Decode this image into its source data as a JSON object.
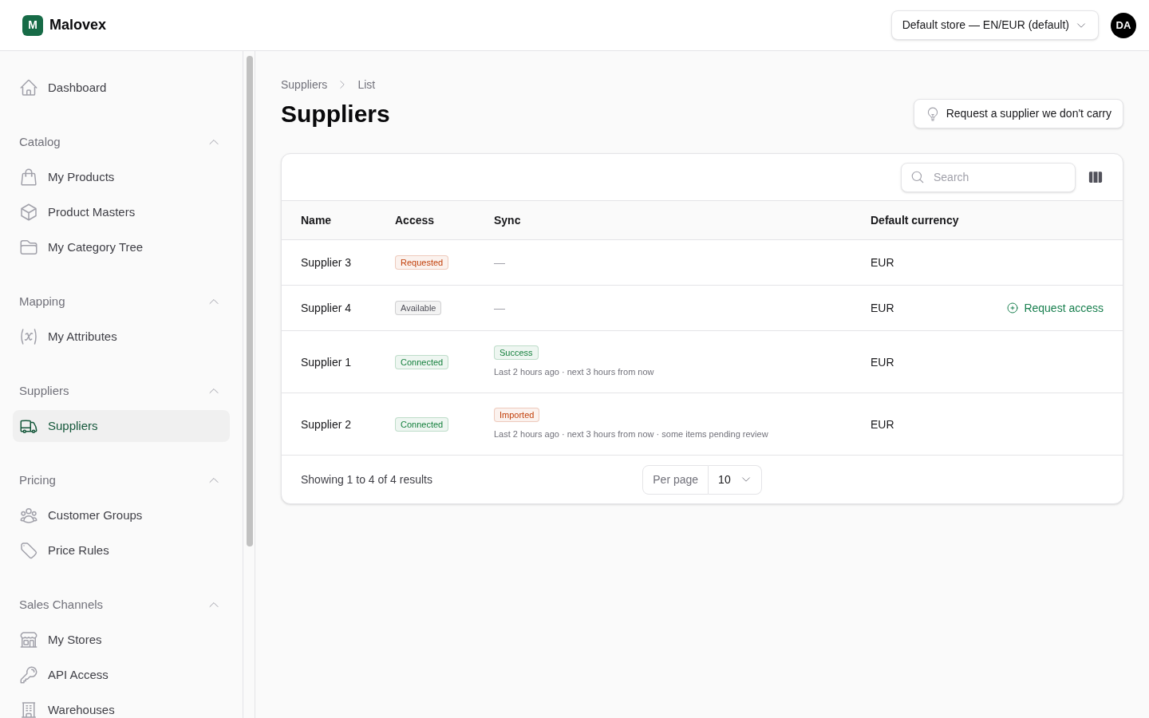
{
  "header": {
    "logo": {
      "letter": "M",
      "name": "Malovex"
    },
    "store_selector": {
      "value": "Default store — EN/EUR (default)"
    },
    "avatar": {
      "initials": "DA"
    }
  },
  "sidebar": {
    "items": [
      {
        "label": "Dashboard",
        "selected": false
      }
    ],
    "sections": [
      {
        "title": "Catalog",
        "expanded": true,
        "items": [
          {
            "label": "My Products",
            "selected": false
          },
          {
            "label": "Product Masters",
            "selected": false
          },
          {
            "label": "My Category Tree",
            "selected": false
          }
        ]
      },
      {
        "title": "Mapping",
        "expanded": true,
        "items": [
          {
            "label": "My Attributes",
            "selected": false
          }
        ]
      },
      {
        "title": "Suppliers",
        "expanded": true,
        "items": [
          {
            "label": "Suppliers",
            "selected": true
          }
        ]
      },
      {
        "title": "Pricing",
        "expanded": true,
        "items": [
          {
            "label": "Customer Groups",
            "selected": false
          },
          {
            "label": "Price Rules",
            "selected": false
          }
        ]
      },
      {
        "title": "Sales Channels",
        "expanded": true,
        "items": [
          {
            "label": "My Stores",
            "selected": false
          },
          {
            "label": "API Access",
            "selected": false
          },
          {
            "label": "Warehouses",
            "selected": false
          }
        ]
      }
    ]
  },
  "page": {
    "breadcrumb": [
      "Suppliers",
      "List"
    ],
    "title": "Suppliers",
    "action_button": "Request a supplier we don't carry"
  },
  "table": {
    "search": {
      "placeholder": "Search"
    },
    "columns": [
      "Name",
      "Access",
      "Sync",
      "Default currency"
    ],
    "rows": [
      {
        "name": "Supplier 3",
        "access": {
          "label": "Requested",
          "color": "#c2410c"
        },
        "sync": {
          "kind": "empty",
          "text": "—"
        },
        "currency": "EUR"
      },
      {
        "name": "Supplier 4",
        "access": {
          "label": "Available",
          "color": "#52525b"
        },
        "sync": {
          "kind": "empty",
          "text": "—"
        },
        "currency": "EUR",
        "action": "Request access"
      },
      {
        "name": "Supplier 1",
        "access": {
          "label": "Connected",
          "color": "#15803d"
        },
        "sync": {
          "kind": "status",
          "label": "Success",
          "color": "#15803d",
          "detail": "Last 2 hours ago · next 3 hours from now"
        },
        "currency": "EUR"
      },
      {
        "name": "Supplier 2",
        "access": {
          "label": "Connected",
          "color": "#15803d"
        },
        "sync": {
          "kind": "status",
          "label": "Imported",
          "color": "#c2410c",
          "detail": "Last 2 hours ago · next 3 hours from now · some items pending review"
        },
        "currency": "EUR"
      }
    ],
    "footer": {
      "summary": "Showing 1 to 4 of 4 results",
      "per_page": {
        "label": "Per page",
        "value": "10"
      }
    }
  }
}
